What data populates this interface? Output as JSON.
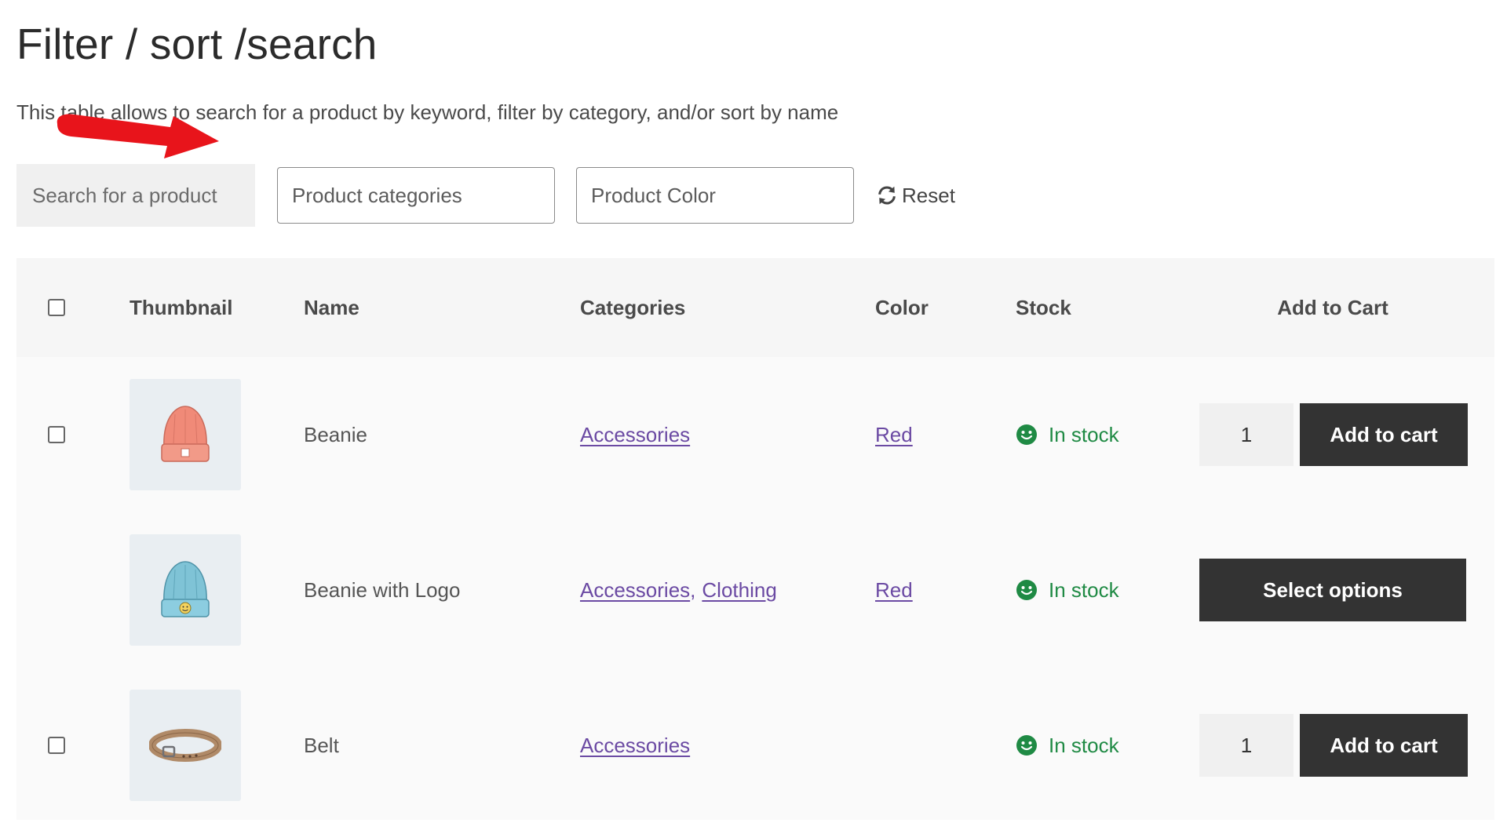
{
  "page": {
    "title": "Filter / sort /search",
    "description": "This table allows to search for a product by keyword, filter by category, and/or sort by name"
  },
  "filters": {
    "search_placeholder": "Search for a product",
    "categories_placeholder": "Product categories",
    "color_placeholder": "Product Color",
    "reset_label": "Reset"
  },
  "table": {
    "headers": {
      "thumbnail": "Thumbnail",
      "name": "Name",
      "categories": "Categories",
      "color": "Color",
      "stock": "Stock",
      "add_to_cart": "Add to Cart"
    },
    "rows": [
      {
        "name": "Beanie",
        "category1": "Accessories",
        "category2": "",
        "color": "Red",
        "stock": "In stock",
        "qty": "1",
        "action": "Add to cart",
        "thumbnail_icon": "red-beanie-image"
      },
      {
        "name": "Beanie with Logo",
        "category1": "Accessories",
        "category_sep": ",",
        "category2": "Clothing",
        "color": "Red",
        "stock": "In stock",
        "action": "Select options",
        "thumbnail_icon": "blue-beanie-logo-image"
      },
      {
        "name": "Belt",
        "category1": "Accessories",
        "category2": "",
        "color": "",
        "stock": "In stock",
        "qty": "1",
        "action": "Add to cart",
        "thumbnail_icon": "belt-image"
      }
    ]
  },
  "colors": {
    "accent_button": "#333333",
    "link": "#6b4aa3",
    "in_stock": "#1f8a44",
    "annotation_arrow": "#e8141b"
  }
}
